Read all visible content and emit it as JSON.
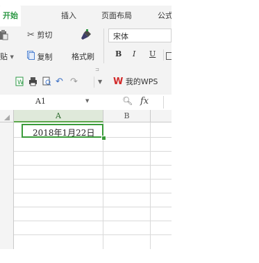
{
  "ribbon_tabs": [
    {
      "label": "开始",
      "active": true
    },
    {
      "label": "插入",
      "active": false
    },
    {
      "label": "页面布局",
      "active": false
    },
    {
      "label": "公式",
      "active": false
    }
  ],
  "clipboard": {
    "cut_label": "剪切",
    "paste_label": "贴",
    "copy_label": "复制",
    "format_painter_label": "格式刷"
  },
  "font": {
    "name": "宋体",
    "bold": "B",
    "italic": "I",
    "underline": "U"
  },
  "quick_access": {
    "wps_label": "我的WPS"
  },
  "formula_bar": {
    "cell_ref": "A1",
    "fx": "fx",
    "formula": ""
  },
  "sheet": {
    "columns": [
      "A",
      "B"
    ],
    "cells": {
      "A1": "2018年1月22日"
    }
  },
  "colors": {
    "accent_green": "#2e9946",
    "wps_red": "#d22a2a",
    "selection": "#3a9b3a"
  }
}
